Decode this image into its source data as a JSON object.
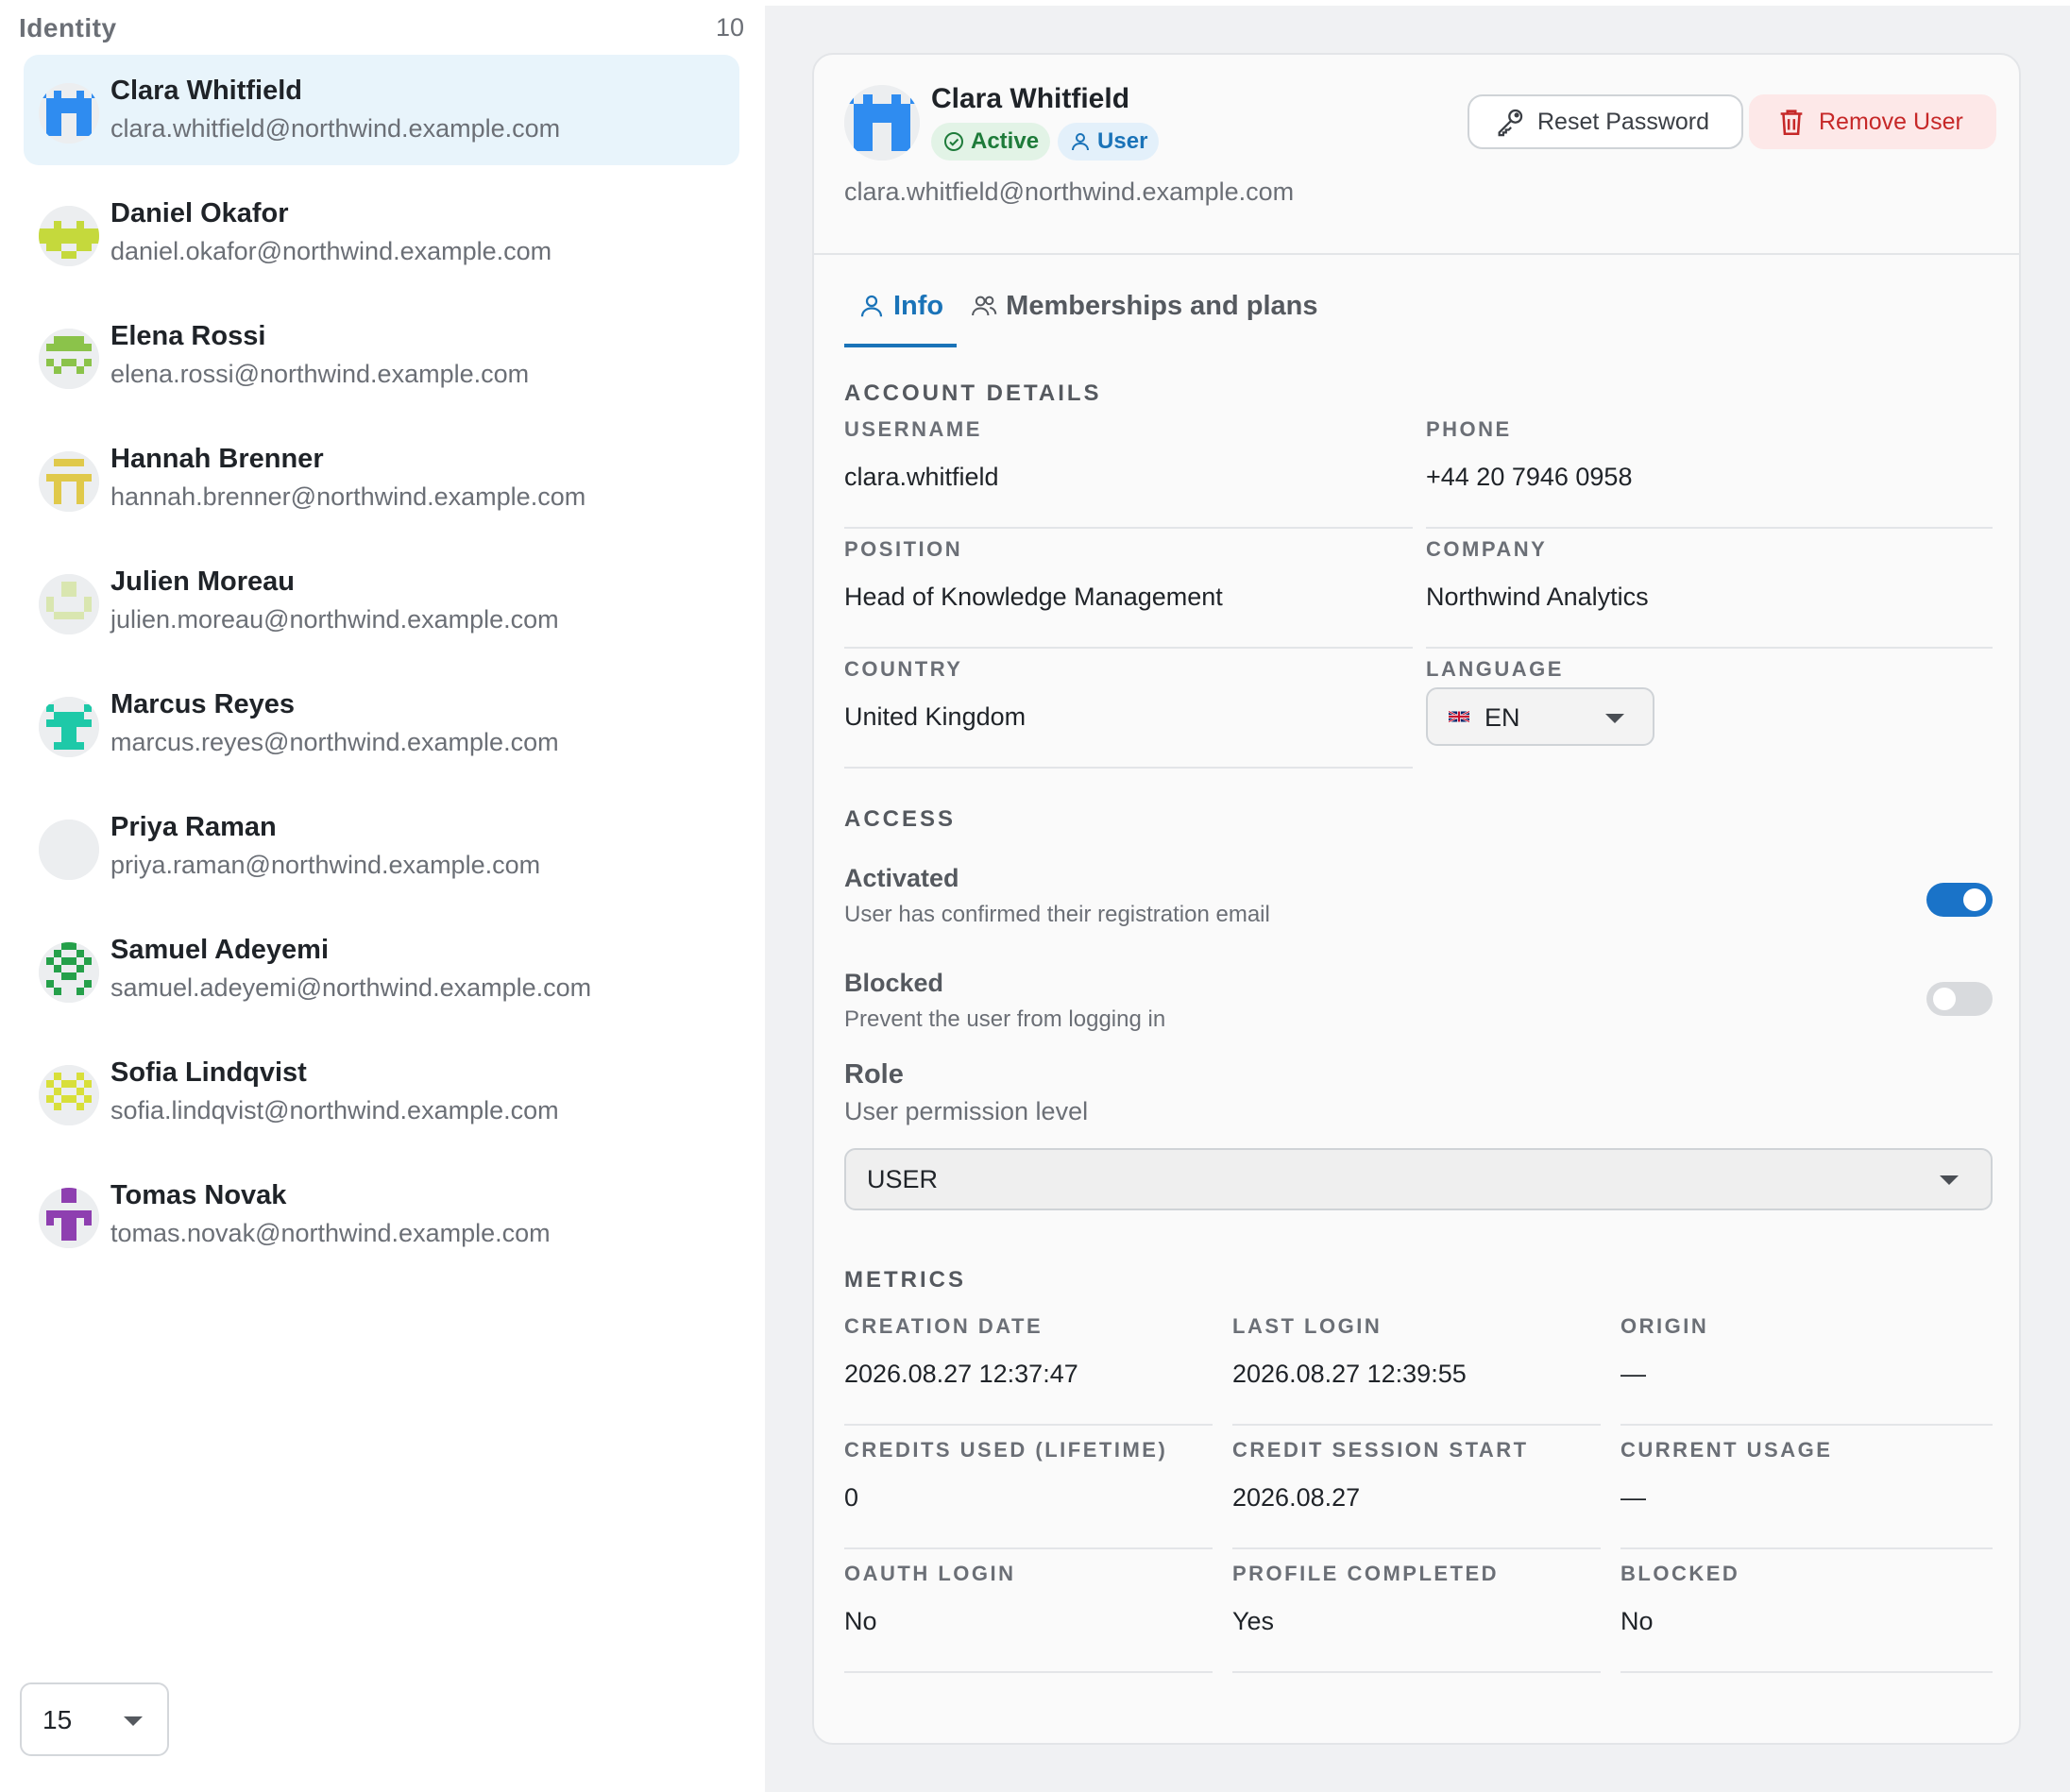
{
  "sidebar": {
    "title": "Identity",
    "count": "10",
    "users": [
      {
        "name": "Clara Whitfield",
        "email": "clara.whitfield@northwind.example.com",
        "avatar_color": "#2f8cf0",
        "pattern": "a",
        "selected": true
      },
      {
        "name": "Daniel Okafor",
        "email": "daniel.okafor@northwind.example.com",
        "avatar_color": "#c5d93c",
        "pattern": "b"
      },
      {
        "name": "Elena Rossi",
        "email": "elena.rossi@northwind.example.com",
        "avatar_color": "#8bc34a",
        "pattern": "c"
      },
      {
        "name": "Hannah Brenner",
        "email": "hannah.brenner@northwind.example.com",
        "avatar_color": "#e0c94a",
        "pattern": "d"
      },
      {
        "name": "Julien Moreau",
        "email": "julien.moreau@northwind.example.com",
        "avatar_color": "#d9e6b0",
        "pattern": "e"
      },
      {
        "name": "Marcus Reyes",
        "email": "marcus.reyes@northwind.example.com",
        "avatar_color": "#1ec9a8",
        "pattern": "f"
      },
      {
        "name": "Priya Raman",
        "email": "priya.raman@northwind.example.com",
        "avatar_color": "#eceef0",
        "pattern": "none"
      },
      {
        "name": "Samuel Adeyemi",
        "email": "samuel.adeyemi@northwind.example.com",
        "avatar_color": "#25a04a",
        "pattern": "g"
      },
      {
        "name": "Sofia Lindqvist",
        "email": "sofia.lindqvist@northwind.example.com",
        "avatar_color": "#d8df3a",
        "pattern": "h"
      },
      {
        "name": "Tomas Novak",
        "email": "tomas.novak@northwind.example.com",
        "avatar_color": "#8e3fb0",
        "pattern": "i"
      }
    ],
    "page_size": "15"
  },
  "detail": {
    "name": "Clara Whitfield",
    "email": "clara.whitfield@northwind.example.com",
    "avatar_color": "#2f8cf0",
    "badges": {
      "status": "Active",
      "role": "User"
    },
    "buttons": {
      "reset": "Reset Password",
      "remove": "Remove User"
    },
    "tabs": {
      "info": "Info",
      "memberships": "Memberships and plans"
    },
    "account": {
      "section": "ACCOUNT DETAILS",
      "username_label": "USERNAME",
      "username": "clara.whitfield",
      "phone_label": "PHONE",
      "phone": "+44 20 7946 0958",
      "position_label": "POSITION",
      "position": "Head of Knowledge Management",
      "company_label": "COMPANY",
      "company": "Northwind Analytics",
      "country_label": "COUNTRY",
      "country": "United Kingdom",
      "language_label": "LANGUAGE",
      "language": "EN"
    },
    "access": {
      "section": "ACCESS",
      "activated_title": "Activated",
      "activated_desc": "User has confirmed their registration email",
      "activated_on": true,
      "blocked_title": "Blocked",
      "blocked_desc": "Prevent the user from logging in",
      "blocked_on": false
    },
    "role": {
      "title": "Role",
      "desc": "User permission level",
      "value": "USER"
    },
    "metrics": {
      "section": "METRICS",
      "creation_label": "CREATION DATE",
      "creation": "2026.08.27 12:37:47",
      "last_login_label": "LAST LOGIN",
      "last_login": "2026.08.27 12:39:55",
      "origin_label": "ORIGIN",
      "origin": "—",
      "credits_label": "CREDITS USED (LIFETIME)",
      "credits": "0",
      "session_label": "CREDIT SESSION START",
      "session": "2026.08.27",
      "usage_label": "CURRENT USAGE",
      "usage": "—",
      "oauth_label": "OAUTH LOGIN",
      "oauth": "No",
      "profile_label": "PROFILE COMPLETED",
      "profile": "Yes",
      "blocked_label": "BLOCKED",
      "blocked": "No"
    }
  },
  "colors": {
    "accent": "#1a73b8",
    "danger": "#c62828",
    "success": "#1e7b3a"
  }
}
